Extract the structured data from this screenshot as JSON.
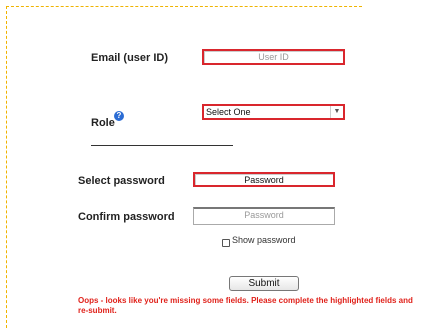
{
  "form": {
    "email_label": "Email (user ID)",
    "email_placeholder": "User ID",
    "role_label": "Role",
    "help_symbol": "?",
    "role_selected": "Select One",
    "select_password_label": "Select password",
    "password_value": "Password",
    "confirm_password_label": "Confirm password",
    "confirm_password_placeholder": "Password",
    "show_password_label": "Show password",
    "submit_label": "Submit",
    "error_message": "Oops - looks like you're missing some fields. Please complete the highlighted fields and re-submit."
  },
  "colors": {
    "error_border": "#d9262d",
    "error_text": "#e0221b",
    "frame_dash": "#f0b400",
    "help_icon": "#2b6cd4"
  },
  "icons": {
    "help": "question-circle-icon",
    "dropdown": "chevron-down-icon"
  }
}
